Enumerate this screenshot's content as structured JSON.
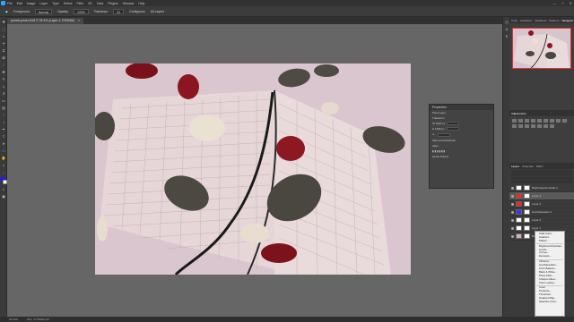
{
  "menu": [
    "File",
    "Edit",
    "Image",
    "Layer",
    "Type",
    "Select",
    "Filter",
    "3D",
    "View",
    "Plugins",
    "Window",
    "Help"
  ],
  "options": {
    "mode_label": "Foreground",
    "mode_value": "Normal",
    "opacity_label": "Opacity",
    "opacity_value": "100%",
    "tolerance_label": "Tolerance",
    "tolerance_value": "32",
    "contiguous": "Contiguous",
    "all_layers": "All Layers"
  },
  "doc_tab": {
    "title": "pexels-photo-818 © 33.3% (Layer 4, RGB/8#)",
    "close": "×"
  },
  "properties": {
    "title": "Properties",
    "subtitle": "Pixel Layer",
    "transform": "Transform",
    "w": "W 1920 px",
    "h": "H 1280 px",
    "align": "Align and Distribute",
    "align_sub": "Align:",
    "quick": "Quick Actions"
  },
  "panel_tabs": [
    "Color",
    "Swatches",
    "Gradients",
    "Patterns",
    "Navigator"
  ],
  "adjust_title": "Adjustments",
  "layer_tabs": [
    "Layers",
    "Channels",
    "Paths"
  ],
  "layers": [
    {
      "name": "Brightness/Contrast 1",
      "thumb": "#ffffff",
      "sel": false
    },
    {
      "name": "Layer 4",
      "thumb": "#ff2222",
      "sel": true
    },
    {
      "name": "Layer 3",
      "thumb": "#ff2222",
      "sel": false
    },
    {
      "name": "Hue/Saturation 1",
      "thumb": "#3333ff",
      "sel": false
    },
    {
      "name": "Layer 2",
      "thumb": "#ffffff",
      "sel": false
    },
    {
      "name": "Layer 1",
      "thumb": "#ffffff",
      "sel": false
    },
    {
      "name": "Background",
      "thumb": "#c9b6bd",
      "sel": false
    }
  ],
  "context_menu": [
    "Solid Color...",
    "Gradient...",
    "Pattern...",
    "",
    "Brightness/Contrast...",
    "Levels...",
    "Curves...",
    "Exposure...",
    "",
    "Vibrance...",
    "Hue/Saturation...",
    "Color Balance...",
    "Black & White...",
    "Photo Filter...",
    "Channel Mixer...",
    "Color Lookup...",
    "",
    "Invert",
    "Posterize...",
    "Threshold...",
    "Gradient Map...",
    "Selective Color..."
  ],
  "status": {
    "zoom": "33.33%",
    "doc": "Doc: 17.6M/82.1M"
  }
}
